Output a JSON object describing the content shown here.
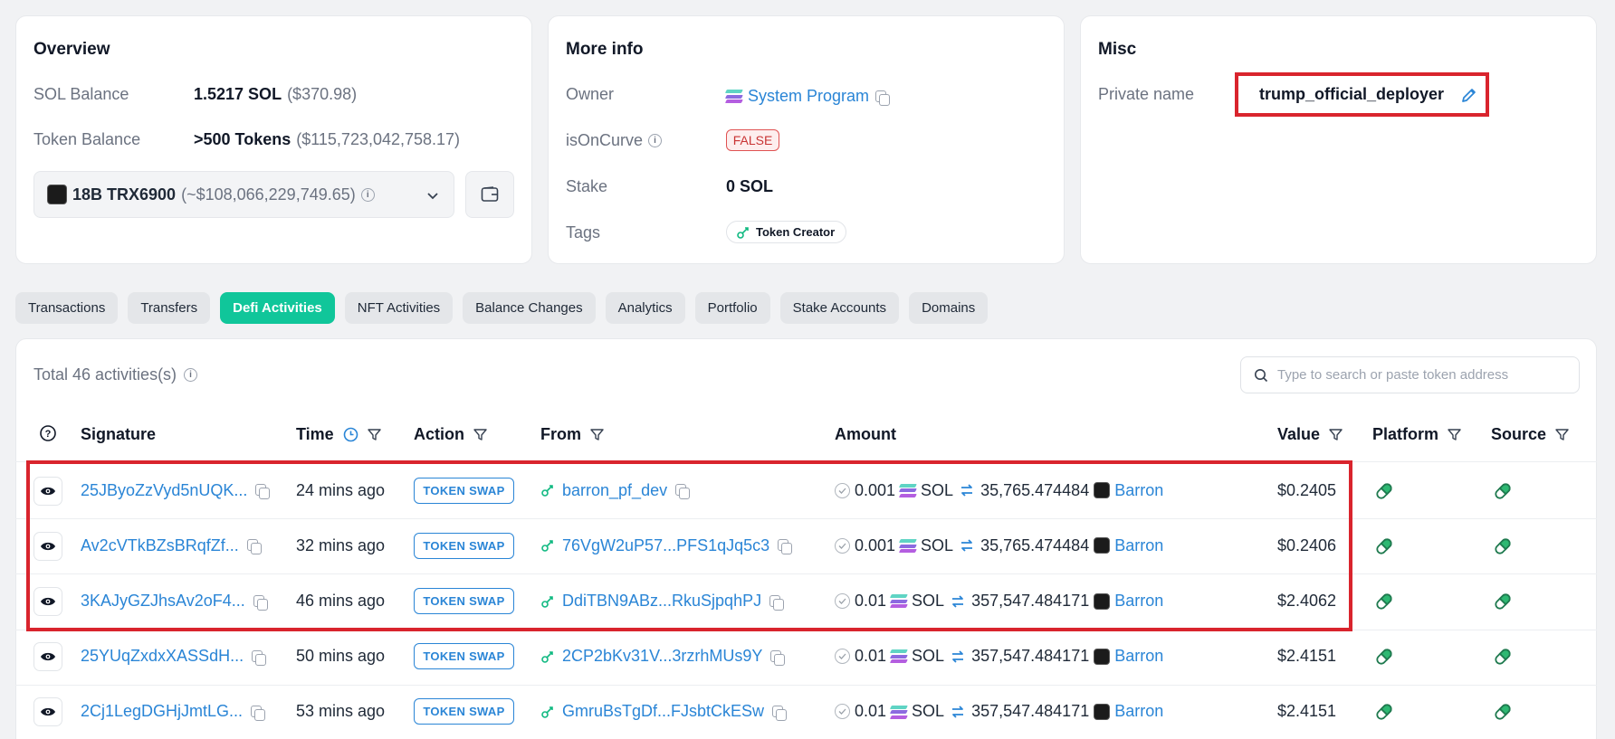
{
  "overview": {
    "title": "Overview",
    "sol_balance_label": "SOL Balance",
    "sol_balance_value": "1.5217 SOL",
    "sol_balance_usd": "($370.98)",
    "token_balance_label": "Token Balance",
    "token_balance_value": ">500 Tokens",
    "token_balance_usd": "($115,723,042,758.17)",
    "token_selector_value": "18B TRX6900",
    "token_selector_usd": "(~$108,066,229,749.65)"
  },
  "more_info": {
    "title": "More info",
    "owner_label": "Owner",
    "owner_value": "System Program",
    "is_on_curve_label": "isOnCurve",
    "is_on_curve_value": "FALSE",
    "stake_label": "Stake",
    "stake_value": "0 SOL",
    "tags_label": "Tags",
    "tag_value": "Token Creator"
  },
  "misc": {
    "title": "Misc",
    "private_name_label": "Private name",
    "private_name_value": "trump_official_deployer"
  },
  "tabs": [
    {
      "label": "Transactions",
      "active": false
    },
    {
      "label": "Transfers",
      "active": false
    },
    {
      "label": "Defi Activities",
      "active": true
    },
    {
      "label": "NFT Activities",
      "active": false
    },
    {
      "label": "Balance Changes",
      "active": false
    },
    {
      "label": "Analytics",
      "active": false
    },
    {
      "label": "Portfolio",
      "active": false
    },
    {
      "label": "Stake Accounts",
      "active": false
    },
    {
      "label": "Domains",
      "active": false
    }
  ],
  "activities": {
    "total_text": "Total 46 activities(s)",
    "search_placeholder": "Type to search or paste token address",
    "columns": {
      "signature": "Signature",
      "time": "Time",
      "action": "Action",
      "from": "From",
      "amount": "Amount",
      "value": "Value",
      "platform": "Platform",
      "source": "Source"
    },
    "rows": [
      {
        "signature": "25JByoZzVyd5nUQK...",
        "time": "24 mins ago",
        "action": "TOKEN SWAP",
        "from": "barron_pf_dev",
        "amount_in": "0.001",
        "token_in": "SOL",
        "amount_out": "35,765.474484",
        "token_out": "Barron",
        "value": "$0.2405"
      },
      {
        "signature": "Av2cVTkBZsBRqfZf...",
        "time": "32 mins ago",
        "action": "TOKEN SWAP",
        "from": "76VgW2uP57...PFS1qJq5c3",
        "amount_in": "0.001",
        "token_in": "SOL",
        "amount_out": "35,765.474484",
        "token_out": "Barron",
        "value": "$0.2406"
      },
      {
        "signature": "3KAJyGZJhsAv2oF4...",
        "time": "46 mins ago",
        "action": "TOKEN SWAP",
        "from": "DdiTBN9ABz...RkuSjpqhPJ",
        "amount_in": "0.01",
        "token_in": "SOL",
        "amount_out": "357,547.484171",
        "token_out": "Barron",
        "value": "$2.4062"
      },
      {
        "signature": "25YUqZxdxXASSdH...",
        "time": "50 mins ago",
        "action": "TOKEN SWAP",
        "from": "2CP2bKv31V...3rzrhMUs9Y",
        "amount_in": "0.01",
        "token_in": "SOL",
        "amount_out": "357,547.484171",
        "token_out": "Barron",
        "value": "$2.4151"
      },
      {
        "signature": "2Cj1LegDGHjJmtLG...",
        "time": "53 mins ago",
        "action": "TOKEN SWAP",
        "from": "GmruBsTgDf...FJsbtCkESw",
        "amount_in": "0.01",
        "token_in": "SOL",
        "amount_out": "357,547.484171",
        "token_out": "Barron",
        "value": "$2.4151"
      }
    ]
  },
  "colors": {
    "accent_green": "#10c69a",
    "link_blue": "#2a85d6",
    "highlight_red": "#d9242d",
    "false_red": "#c93434"
  }
}
